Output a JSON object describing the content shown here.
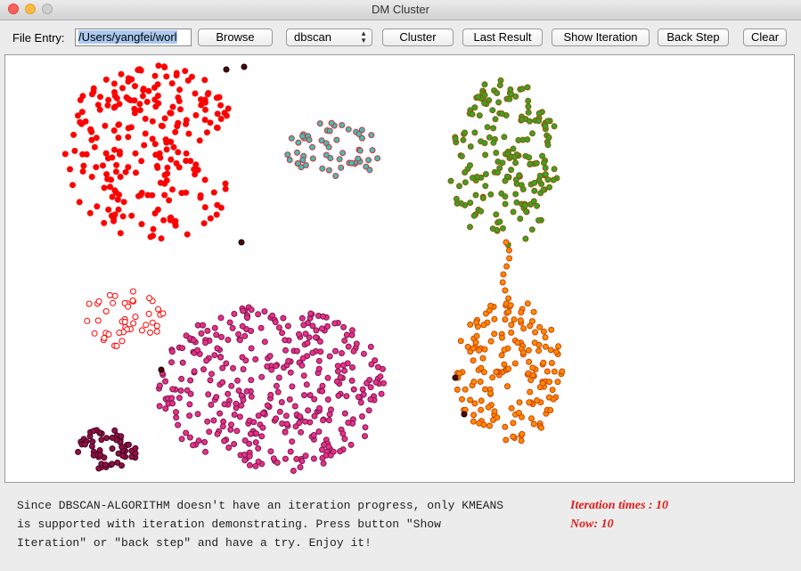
{
  "window": {
    "title": "DM Cluster"
  },
  "toolbar": {
    "file_label": "File Entry:",
    "file_value": "/Users/yangfei/worl",
    "browse_label": "Browse",
    "algorithm_selected": "dbscan",
    "cluster_label": "Cluster",
    "last_result_label": "Last Result",
    "show_iteration_label": "Show Iteration",
    "back_step_label": "Back Step",
    "clear_label": "Clear"
  },
  "status": {
    "message_lines": [
      "Since DBSCAN-ALGORITHM doesn't have an iteration progress, only KMEANS",
      "is supported with iteration demonstrating. Press button \"Show",
      "Iteration\" or \"back step\" and have a try. Enjoy it!"
    ],
    "iteration_times": "Iteration times : 10",
    "now": "Now: 10"
  },
  "colors": {
    "red": "#ff0000",
    "cyan": "#3fbfbf",
    "green": "#3aa22a",
    "orange": "#ff8a00",
    "pink": "#e8308c",
    "light_red": "#ffffff",
    "maroon": "#8b1245",
    "noise": "#5a0000"
  }
}
